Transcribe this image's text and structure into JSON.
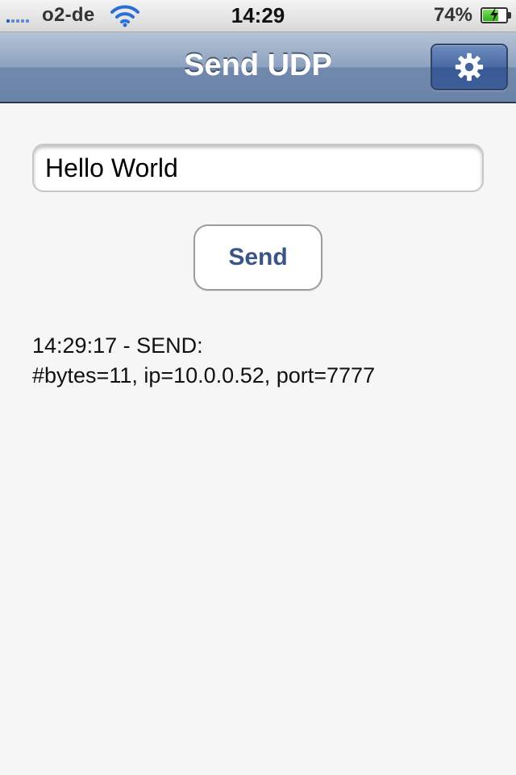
{
  "status_bar": {
    "carrier": "o2-de",
    "time": "14:29",
    "battery_percent": "74%",
    "battery_level": 0.74,
    "signal_icon": "signal-bars-icon",
    "wifi_icon": "wifi-icon",
    "battery_icon": "battery-charging-icon"
  },
  "nav_bar": {
    "title": "Send UDP",
    "settings_icon": "gear-icon"
  },
  "main": {
    "message_input_value": "Hello World",
    "send_button_label": "Send",
    "log": [
      "14:29:17 - SEND:",
      "#bytes=11, ip=10.0.0.52, port=7777"
    ]
  },
  "colors": {
    "nav_bar": "#8da2bf",
    "settings_button": "#4a6aa3",
    "send_label": "#3a5587",
    "background": "#f6f6f6",
    "battery_fill": "#2fae1a"
  }
}
